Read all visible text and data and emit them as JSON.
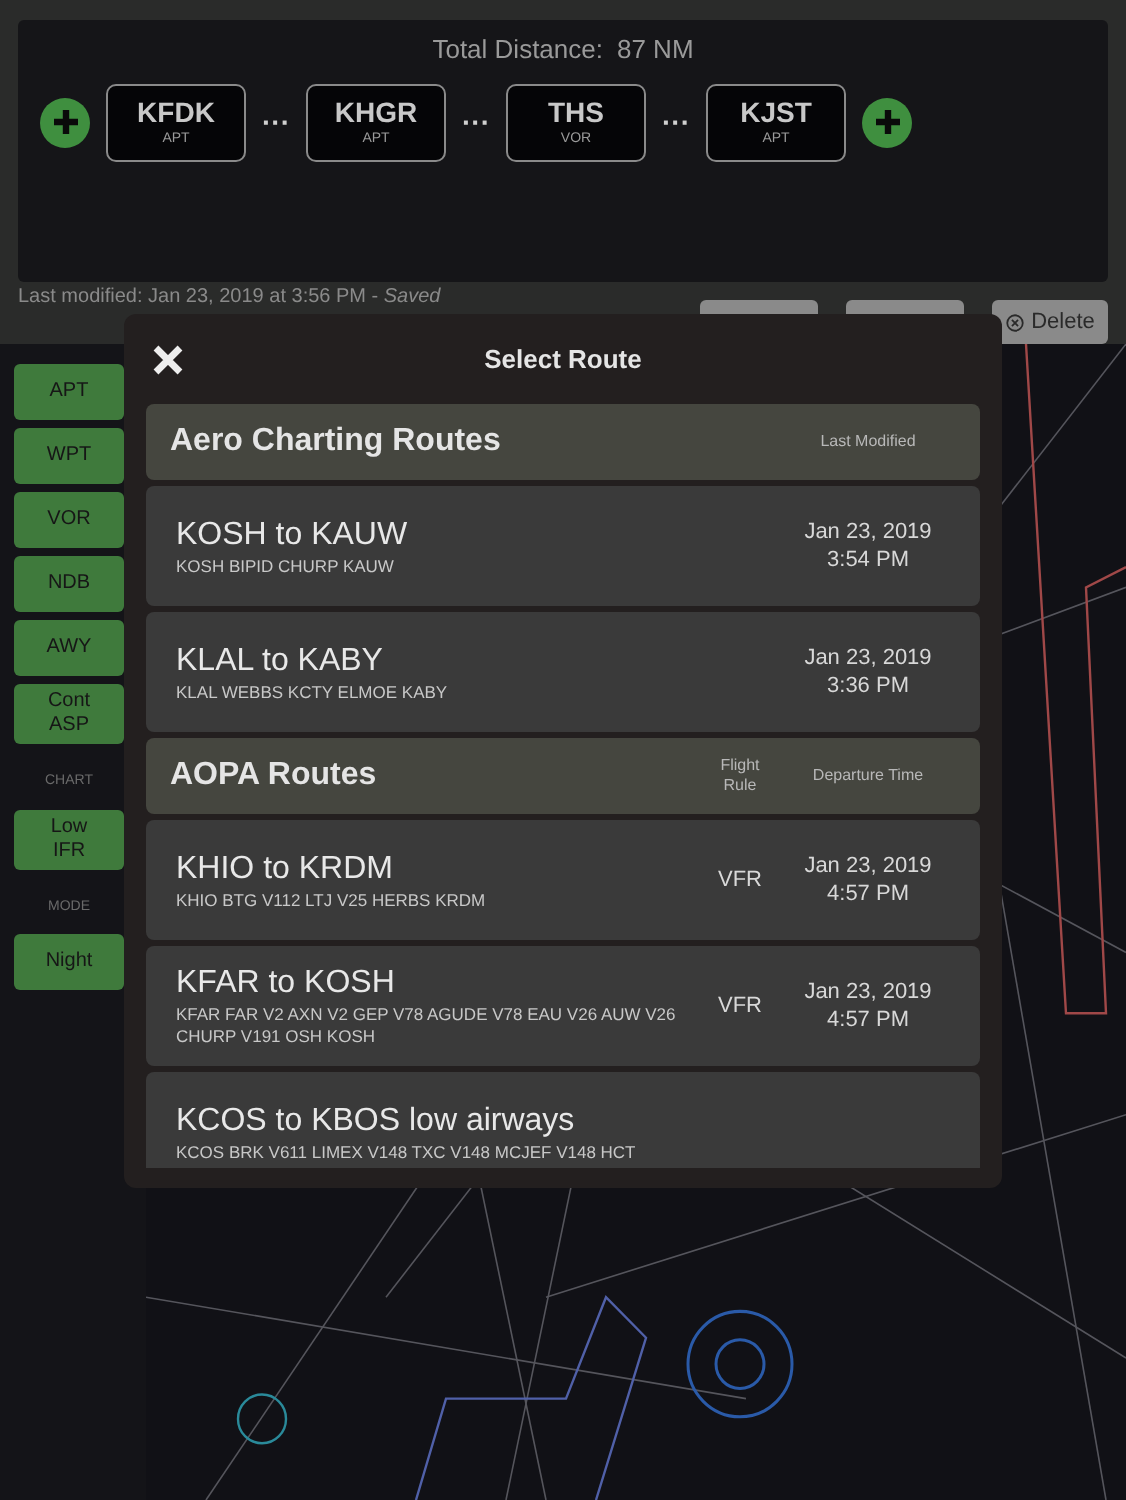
{
  "route_bar": {
    "total_label": "Total Distance:",
    "total_value": "87 NM",
    "waypoints": [
      {
        "id": "KFDK",
        "type": "APT"
      },
      {
        "id": "KHGR",
        "type": "APT"
      },
      {
        "id": "THS",
        "type": "VOR"
      },
      {
        "id": "KJST",
        "type": "APT"
      }
    ],
    "separator": "···"
  },
  "status": {
    "text": "Last modified: Jan 23, 2019 at 3:56 PM - ",
    "state": "Saved"
  },
  "toolbar": {
    "delete_label": "Delete"
  },
  "sidebar": [
    {
      "kind": "button",
      "label": "APT"
    },
    {
      "kind": "button",
      "label": "WPT"
    },
    {
      "kind": "button",
      "label": "VOR"
    },
    {
      "kind": "button",
      "label": "NDB"
    },
    {
      "kind": "button",
      "label": "AWY"
    },
    {
      "kind": "button",
      "label": "Cont ASP"
    },
    {
      "kind": "heading",
      "label": "CHART"
    },
    {
      "kind": "button",
      "label": "Low IFR"
    },
    {
      "kind": "heading",
      "label": "MODE"
    },
    {
      "kind": "button",
      "label": "Night"
    }
  ],
  "dialog": {
    "title": "Select Route",
    "sections": [
      {
        "title": "Aero Charting Routes",
        "columns": [
          "Last Modified"
        ],
        "routes": [
          {
            "name": "KOSH to KAUW",
            "path": "KOSH BIPID CHURP KAUW",
            "date": "Jan 23, 2019",
            "time": "3:54 PM"
          },
          {
            "name": "KLAL to KABY",
            "path": "KLAL WEBBS KCTY ELMOE KABY",
            "date": "Jan 23, 2019",
            "time": "3:36 PM"
          }
        ]
      },
      {
        "title": "AOPA Routes",
        "columns": [
          "Flight Rule",
          "Departure Time"
        ],
        "routes": [
          {
            "name": "KHIO to KRDM",
            "path": "KHIO BTG V112 LTJ V25 HERBS KRDM",
            "rule": "VFR",
            "date": "Jan 23, 2019",
            "time": "4:57 PM"
          },
          {
            "name": "KFAR to KOSH",
            "path": "KFAR FAR V2 AXN V2 GEP V78 AGUDE V78 EAU V26 AUW V26 CHURP V191 OSH KOSH",
            "rule": "VFR",
            "date": "Jan 23, 2019",
            "time": "4:57 PM"
          },
          {
            "name": "KCOS to KBOS low airways",
            "path": "KCOS BRK V611 LIMEX V148 TXC V148 MCJEF V148 HCT"
          }
        ]
      }
    ]
  }
}
